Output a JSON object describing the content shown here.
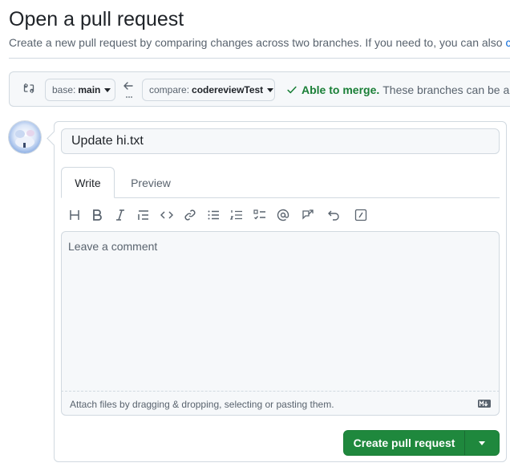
{
  "header": {
    "title": "Open a pull request",
    "subtitle_prefix": "Create a new pull request by comparing changes across two branches. If you need to, you can also ",
    "subtitle_link": "co"
  },
  "range": {
    "base_label": "base:",
    "base_branch": "main",
    "compare_label": "compare:",
    "compare_branch": "codereviewTest",
    "merge_ok": "Able to merge.",
    "merge_rest": "These branches can be aut"
  },
  "form": {
    "title_value": "Update hi.txt",
    "tabs": [
      {
        "label": "Write"
      },
      {
        "label": "Preview"
      }
    ],
    "toolbar_icons": [
      "heading-icon",
      "bold-icon",
      "italic-icon",
      "quote-icon",
      "code-icon",
      "link-icon",
      "unordered-list-icon",
      "ordered-list-icon",
      "task-list-icon",
      "mention-icon",
      "cross-reference-icon",
      "undo-icon",
      "slash-commands-icon"
    ],
    "comment_placeholder": "Leave a comment",
    "attach_text": "Attach files by dragging & dropping, selecting or pasting them.",
    "submit_label": "Create pull request"
  },
  "colors": {
    "accent_green": "#1f883d",
    "merge_green": "#1a7f37",
    "link_blue": "#0969da"
  }
}
